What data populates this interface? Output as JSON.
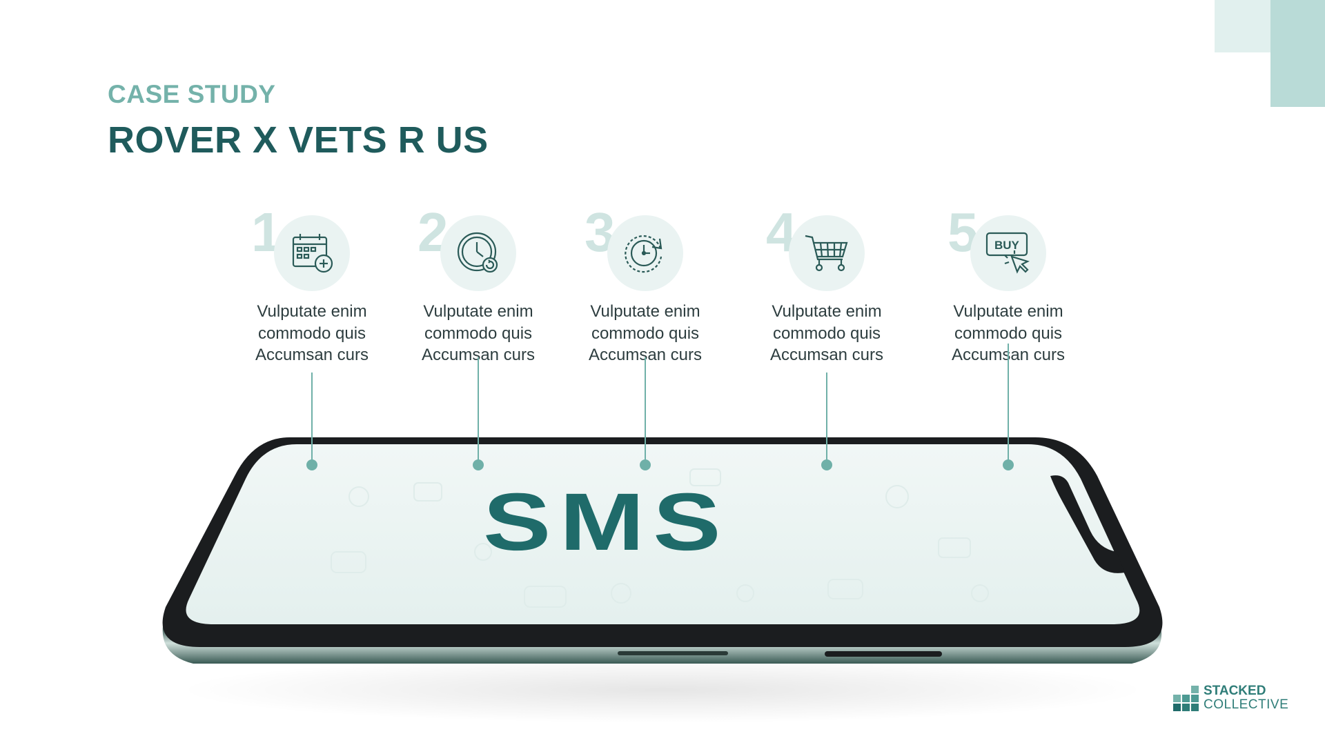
{
  "header": {
    "kicker": "CASE STUDY",
    "title": "ROVER X VETS R US"
  },
  "steps": [
    {
      "number": "1",
      "icon": "calendar-add-icon",
      "lines": [
        "Vulputate enim",
        "commodo quis",
        "Accumsan curs"
      ]
    },
    {
      "number": "2",
      "icon": "clock-refresh-icon",
      "lines": [
        "Vulputate enim",
        "commodo quis",
        "Accumsan curs"
      ]
    },
    {
      "number": "3",
      "icon": "timer-cycle-icon",
      "lines": [
        "Vulputate enim",
        "commodo quis",
        "Accumsan curs"
      ]
    },
    {
      "number": "4",
      "icon": "shopping-cart-icon",
      "lines": [
        "Vulputate enim",
        "commodo quis",
        "Accumsan curs"
      ]
    },
    {
      "number": "5",
      "icon": "buy-click-icon",
      "lines": [
        "Vulputate enim",
        "commodo quis",
        "Accumsan curs"
      ]
    }
  ],
  "phone": {
    "screen_text": "SMS",
    "buy_label": "BUY"
  },
  "brand": {
    "line1": "STACKED",
    "line2": "COLLECTIVE"
  },
  "colors": {
    "primary": "#1f5b5c",
    "accent": "#6fb0a8",
    "light": "#e1f0ee"
  }
}
